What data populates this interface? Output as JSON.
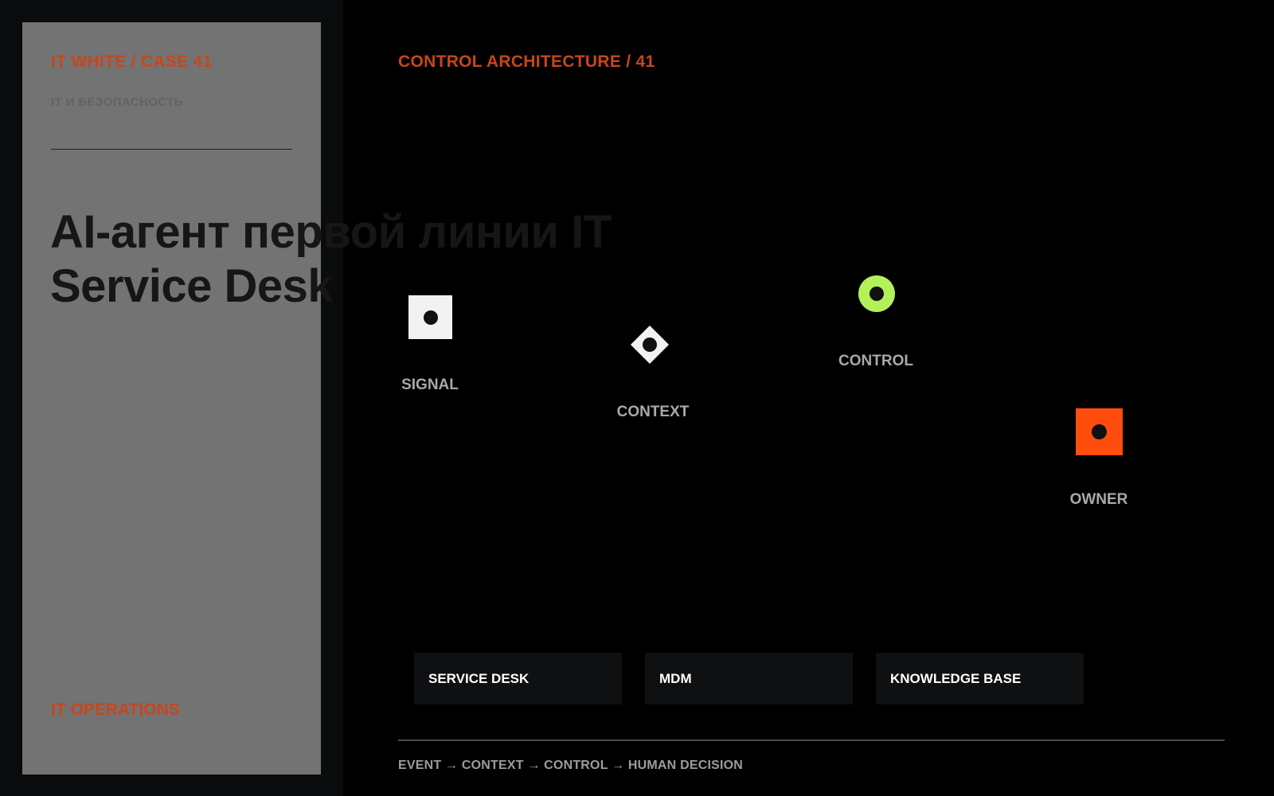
{
  "sidebar": {
    "case_label": "IT WHITE / CASE 41",
    "sub_label": "IT И БЕЗОПАСНОСТЬ",
    "headline_line1": "AI-агент первой линии IT",
    "headline_line2": "Service Desk",
    "footer_label": "IT OPERATIONS"
  },
  "main": {
    "title": "CONTROL ARCHITECTURE / 41",
    "nodes": [
      {
        "label": "SIGNAL",
        "icon": "square-dot-icon",
        "color": "#f2f2f0"
      },
      {
        "label": "CONTEXT",
        "icon": "diamond-dot-icon",
        "color": "#f2f2f0"
      },
      {
        "label": "CONTROL",
        "icon": "circle-dot-icon",
        "color": "#b3f05a"
      },
      {
        "label": "OWNER",
        "icon": "square-dot-icon",
        "color": "#ff4d0d"
      }
    ],
    "systems": [
      "SERVICE DESK",
      "MDM",
      "KNOWLEDGE BASE"
    ],
    "flow": "EVENT → CONTEXT → CONTROL → HUMAN DECISION"
  },
  "colors": {
    "accent": "#c7461c",
    "control_green": "#b3f05a",
    "owner_orange": "#ff4d0d",
    "card_gray": "#737373"
  }
}
